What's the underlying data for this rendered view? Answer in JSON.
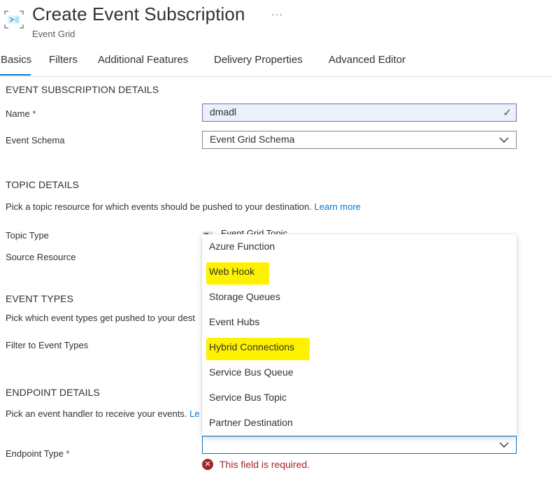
{
  "header": {
    "title": "Create Event Subscription",
    "subtitle": "Event Grid",
    "more_label": "···"
  },
  "tabs": [
    {
      "label": "Basics",
      "active": true
    },
    {
      "label": "Filters"
    },
    {
      "label": "Additional Features"
    },
    {
      "label": "Delivery Properties"
    },
    {
      "label": "Advanced Editor"
    }
  ],
  "event_subscription": {
    "header": "EVENT SUBSCRIPTION DETAILS",
    "name_label": "Name",
    "required_mark": "*",
    "name_value": "dmadl",
    "schema_label": "Event Schema",
    "schema_value": "Event Grid Schema"
  },
  "topic": {
    "header": "TOPIC DETAILS",
    "description": "Pick a topic resource for which events should be pushed to your destination.",
    "learn_more": "Learn more",
    "type_label": "Topic Type",
    "type_value": "Event Grid Topic",
    "source_label": "Source Resource"
  },
  "event_types": {
    "header": "EVENT TYPES",
    "description": "Pick which event types get pushed to your dest",
    "filter_label": "Filter to Event Types"
  },
  "endpoint": {
    "header": "ENDPOINT DETAILS",
    "description": "Pick an event handler to receive your events.",
    "learn_more": "Le",
    "type_label": "Endpoint Type",
    "required_mark": "*",
    "type_value": "",
    "error": "This field is required.",
    "options": [
      "Azure Function",
      "Web Hook",
      "Storage Queues",
      "Event Hubs",
      "Hybrid Connections",
      "Service Bus Queue",
      "Service Bus Topic",
      "Partner Destination"
    ],
    "highlighted": [
      "Web Hook",
      "Hybrid Connections"
    ]
  },
  "colors": {
    "accent": "#0078d4",
    "error": "#a4262c",
    "highlight": "#fff200",
    "success": "#107c10"
  }
}
